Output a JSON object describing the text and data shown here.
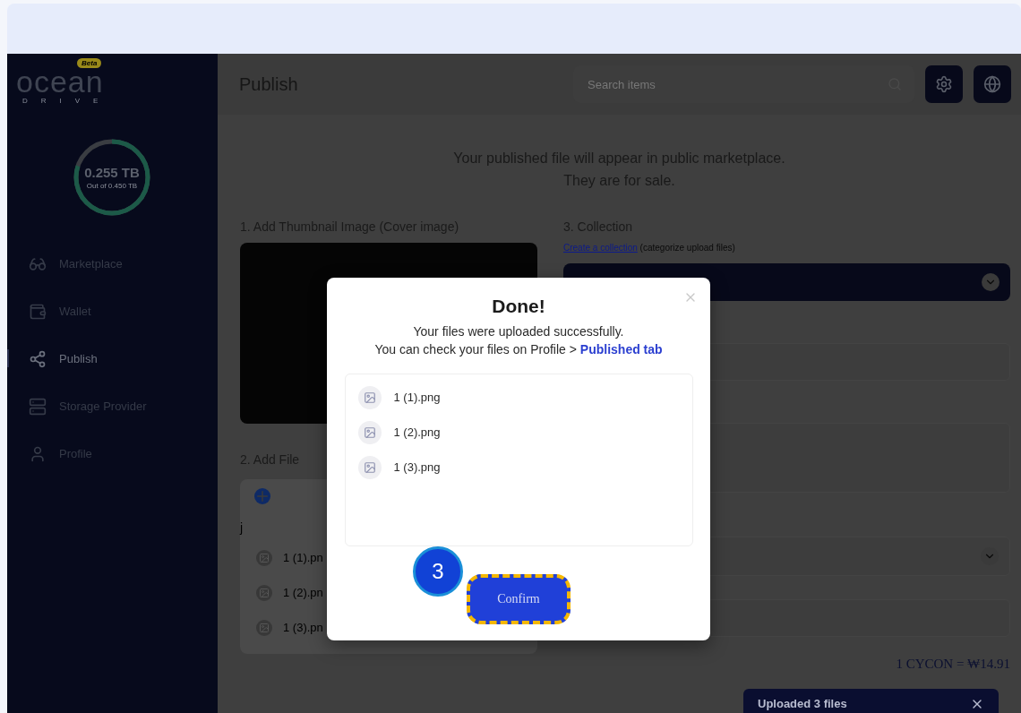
{
  "logo": {
    "name": "ocean",
    "sub": "DRIVE",
    "badge": "Beta"
  },
  "storage": {
    "used": "0.255 TB",
    "total": "Out of 0.450 TB",
    "level": 0.8
  },
  "nav": [
    {
      "label": "Marketplace",
      "kind": "market",
      "selected": false
    },
    {
      "label": "Wallet",
      "kind": "wallet",
      "selected": false
    },
    {
      "label": "Publish",
      "kind": "share",
      "selected": true
    },
    {
      "label": "Storage Provider",
      "kind": "server",
      "selected": false
    },
    {
      "label": "Profile",
      "kind": "user",
      "selected": false
    }
  ],
  "header": {
    "title": "Publish",
    "search_placeholder": "Search items"
  },
  "intro": [
    "Your published file will appear in public marketplace.",
    "They are for sale."
  ],
  "thumbnail": {
    "label": "1. Add Thumbnail Image (Cover image)"
  },
  "add_file": {
    "label": "2. Add File",
    "folder": "j",
    "files": [
      "1 (1).pn",
      "1 (2).pn",
      "1 (3).pn"
    ]
  },
  "collection": {
    "label": "3. Collection",
    "link": "Create a collection",
    "hint": "(categorize upload files)"
  },
  "rate": "1 CYCON = ₩14.91",
  "modal": {
    "title": "Done!",
    "message": "Your files were uploaded successfully.",
    "hint": "You can check your files on Profile > ",
    "link": "Published tab",
    "files": [
      "1 (1).png",
      "1 (2).png",
      "1 (3).png"
    ],
    "confirm": "Confirm",
    "step": "3"
  },
  "toast": {
    "text": "Uploaded 3 files"
  }
}
